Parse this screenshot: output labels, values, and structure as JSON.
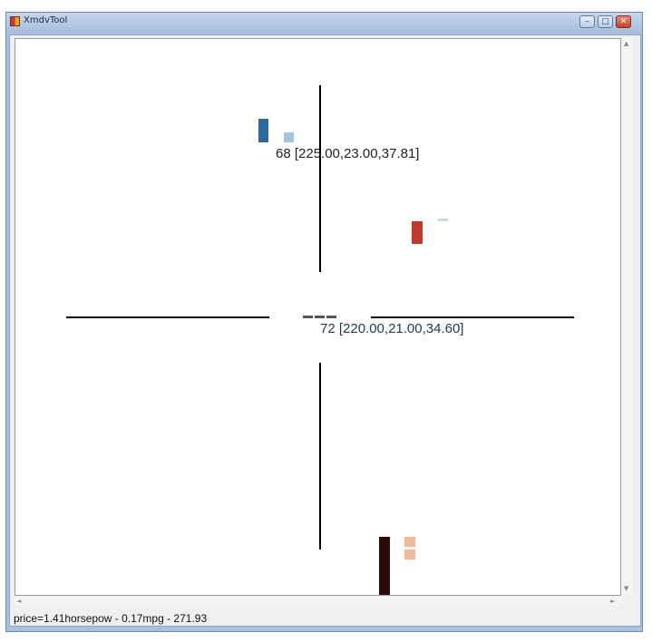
{
  "window": {
    "title": "XmdvTool",
    "buttons": {
      "minimize": "–",
      "maximize": "□",
      "close": "✕"
    },
    "icon": "app-icon"
  },
  "canvas": {
    "glyphs": [
      {
        "label": "68 [225.00,23.00,37.81]",
        "label_color": "#222222",
        "bars": [
          {
            "value": 1.0,
            "color": "#2b6aa0"
          },
          {
            "value": 0.4,
            "color": "#9fc6e2"
          }
        ]
      },
      {
        "label": "",
        "bars": [
          {
            "value": 1.0,
            "color": "#c0392b"
          },
          {
            "value": 0.1,
            "color": "#c9daf0"
          }
        ]
      },
      {
        "label": "72 [220.00,21.00,34.60]",
        "label_color": "#1f3a5a",
        "bars": [
          {
            "value": 0.2,
            "color": "#555555"
          },
          {
            "value": 0.2,
            "color": "#555555"
          },
          {
            "value": 0.2,
            "color": "#555555"
          }
        ]
      },
      {
        "label": "",
        "bars": [
          {
            "value": 1.0,
            "color": "#2a0a0a"
          },
          {
            "value": 0.18,
            "color": "#f3b898"
          },
          {
            "value": 0.18,
            "color": "#f3b898"
          }
        ]
      }
    ]
  },
  "scrollbars": {
    "up": "▲",
    "down": "▼",
    "left": "◄",
    "right": "►"
  },
  "status": {
    "formula": "price=1.41horsepow - 0.17mpg - 271.93"
  }
}
